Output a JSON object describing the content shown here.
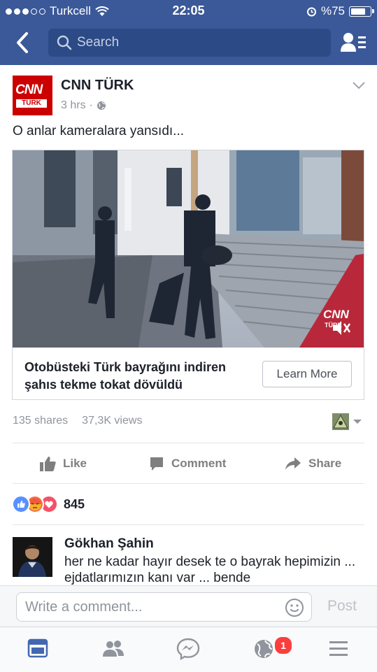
{
  "status": {
    "carrier": "Turkcell",
    "time": "22:05",
    "battery_text": "%75",
    "battery_level": 0.75
  },
  "nav": {
    "search_placeholder": "Search"
  },
  "post": {
    "page_name": "CNN TÜRK",
    "logo_text_top": "CNN",
    "logo_text_bottom": "TÜRK",
    "time": "3 hrs",
    "separator": "·",
    "text": "O anlar kameralara yansıdı...",
    "video_watermark_top": "CNN",
    "video_watermark_bottom": "TÜRK",
    "link_title": "Otobüsteki Türk bayrağını indiren şahıs tekme tokat dövüldü",
    "cta_label": "Learn More",
    "shares": "135 shares",
    "views": "37,3K views",
    "actions": {
      "like": "Like",
      "comment": "Comment",
      "share": "Share"
    },
    "reaction_count": "845",
    "reactions": [
      "like-icon",
      "angry-icon",
      "love-icon"
    ]
  },
  "comment": {
    "author": "Gökhan Şahin",
    "text": "her ne kadar hayır desek te o bayrak hepimizin ... ejdatlarımızın kanı var ... bende"
  },
  "composer": {
    "placeholder": "Write a comment...",
    "post_label": "Post"
  },
  "tabbar": {
    "notifications_badge": "1"
  },
  "colors": {
    "brand": "#3b5998",
    "cnn_red": "#cc0000",
    "badge": "#fa3e3e"
  }
}
